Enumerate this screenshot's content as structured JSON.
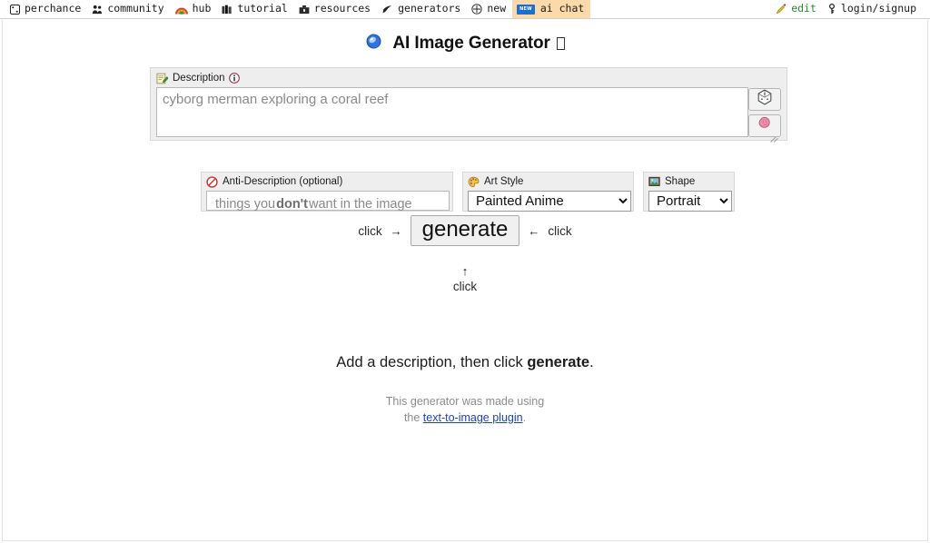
{
  "nav": {
    "left_items": [
      {
        "label": "perchance",
        "icon": "perchance-logo-icon"
      },
      {
        "label": "community",
        "icon": "people-icon"
      },
      {
        "label": "hub",
        "icon": "rainbow-icon"
      },
      {
        "label": "tutorial",
        "icon": "books-icon"
      },
      {
        "label": "resources",
        "icon": "toolbox-icon"
      },
      {
        "label": "generators",
        "icon": "sparkle-icon"
      },
      {
        "label": "new",
        "icon": "plus-circle-icon"
      },
      {
        "label": "ai chat",
        "icon": "new-badge-icon",
        "badge": "NEW",
        "highlight": true
      }
    ],
    "right_items": [
      {
        "label": "edit",
        "icon": "pencil-icon"
      },
      {
        "label": "login/signup",
        "icon": "key-icon"
      }
    ],
    "highlight_color": "#fcd9a8",
    "edit_color": "#2b8a2b",
    "badge_color": "#1a6fd4"
  },
  "header": {
    "title": "AI Image Generator",
    "icon": "blue-gem-icon",
    "trailing_glyph": "missing-glyph-box"
  },
  "description": {
    "label": "Description",
    "label_icon": "memo-icon",
    "info_icon": "info-icon",
    "value": "",
    "placeholder": "cyborg merman exploring a coral reef",
    "buttons": [
      {
        "name": "random-dice-button",
        "icon": "dice-icon"
      },
      {
        "name": "ai-brain-button",
        "icon": "brain-icon"
      }
    ]
  },
  "anti_description": {
    "label": "Anti-Description (optional)",
    "label_icon": "prohibition-icon",
    "value": "",
    "placeholder_parts": [
      "things you ",
      "don't",
      " want in the image"
    ]
  },
  "art_style": {
    "label": "Art Style",
    "label_icon": "palette-icon",
    "selected": "Painted Anime",
    "options": [
      "Painted Anime"
    ]
  },
  "shape": {
    "label": "Shape",
    "label_icon": "framed-picture-icon",
    "selected": "Portrait",
    "options": [
      "Portrait"
    ]
  },
  "generate": {
    "button_label": "generate",
    "click_left": "click",
    "click_right": "click",
    "click_below": "click",
    "arrow_left": "→",
    "arrow_right": "←",
    "arrow_up": "↑"
  },
  "status": {
    "hint_prefix": "Add a description, then click ",
    "hint_bold": "generate",
    "hint_suffix": ".",
    "credit_line1": "This generator was made using",
    "credit_line2_prefix": "the ",
    "credit_link": "text-to-image plugin",
    "credit_line2_suffix": "."
  }
}
